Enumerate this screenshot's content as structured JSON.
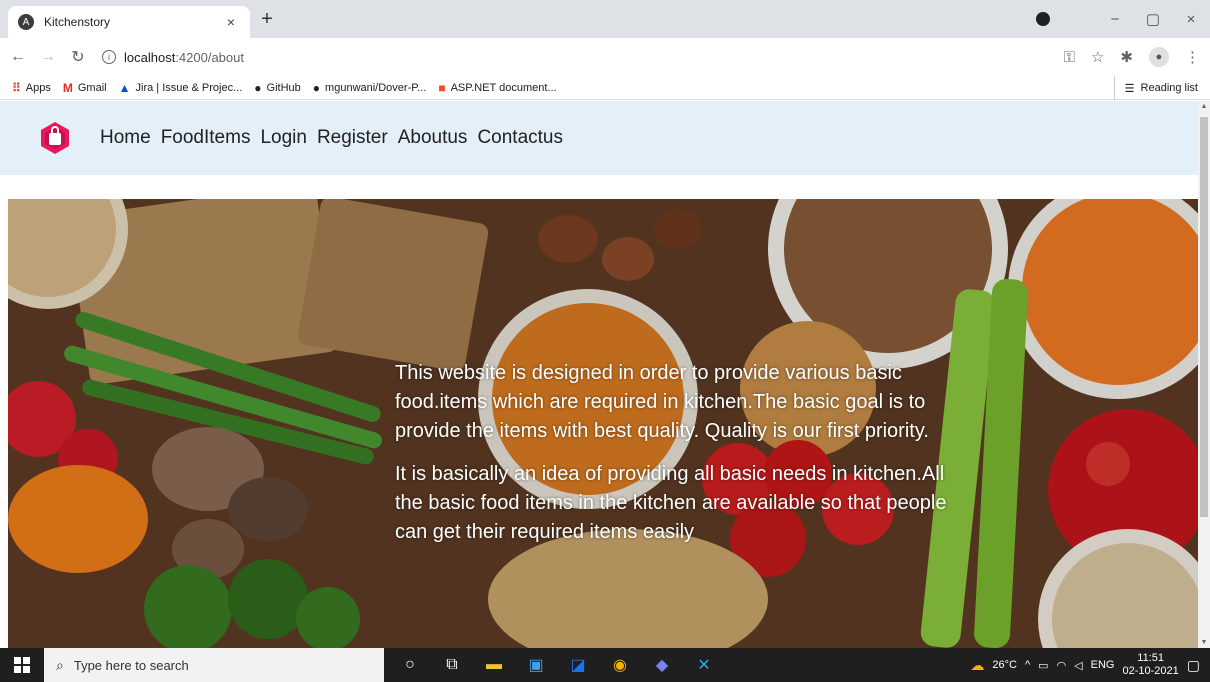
{
  "browser": {
    "tab_title": "Kitchenstory",
    "tab_close": "×",
    "new_tab": "+",
    "url_host": "localhost",
    "url_path": ":4200/about",
    "window_controls": {
      "minimize": "−",
      "maximize": "▢",
      "close": "×"
    }
  },
  "bookmarks": [
    {
      "label": "Apps",
      "icon": "apps-grid-icon"
    },
    {
      "label": "Gmail",
      "icon": "gmail-icon"
    },
    {
      "label": "Jira | Issue & Projec...",
      "icon": "jira-icon"
    },
    {
      "label": "GitHub",
      "icon": "github-icon"
    },
    {
      "label": "mgunwani/Dover-P...",
      "icon": "github-icon"
    },
    {
      "label": "ASP.NET document...",
      "icon": "microsoft-icon"
    }
  ],
  "reading_list": "Reading list",
  "site": {
    "nav": [
      "Home",
      "FoodItems",
      "Login",
      "Register",
      "Aboutus",
      "Contactus"
    ],
    "about_paragraphs": [
      "This website is designed in order to provide various basic food.items which are required in kitchen.The basic goal is to provide the items with best quality. Quality is our first priority.",
      "It is basically an idea of providing all basic needs in kitchen.All the basic food items in the kitchen are available so that people can get their required items easily"
    ]
  },
  "taskbar": {
    "search_placeholder": "Type here to search",
    "weather": "26°C",
    "lang": "ENG",
    "time": "11:51",
    "date": "02-10-2021"
  }
}
